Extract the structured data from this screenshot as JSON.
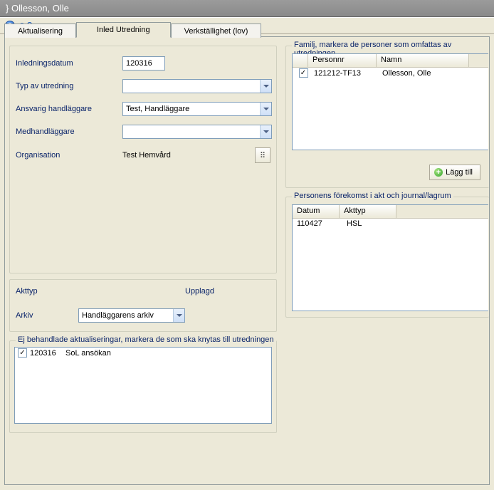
{
  "window": {
    "title": "Ollesson, Olle",
    "title_prefix": "}"
  },
  "tabs": [
    {
      "label": "Aktualisering"
    },
    {
      "label": "Inled Utredning"
    },
    {
      "label": "Verkställighet (lov)"
    }
  ],
  "form": {
    "inledningsdatum_label": "Inledningsdatum",
    "inledningsdatum_value": "120316",
    "typ_label": "Typ av utredning",
    "typ_value": "",
    "ansvarig_label": "Ansvarig handläggare",
    "ansvarig_value": "Test, Handläggare",
    "med_label": "Medhandläggare",
    "med_value": "",
    "org_label": "Organisation",
    "org_value": "Test Hemvård"
  },
  "akt": {
    "akttyp_label": "Akttyp",
    "upplagd_label": "Upplagd",
    "arkiv_label": "Arkiv",
    "arkiv_value": "Handläggarens arkiv"
  },
  "ej_box": {
    "legend": "Ej behandlade aktualiseringar, markera de som ska knytas till utredningen",
    "rows": [
      {
        "checked": true,
        "date": "120316",
        "text": "SoL ansökan"
      }
    ]
  },
  "familj": {
    "legend": "Familj, markera de personer som omfattas av utredningen",
    "cols": {
      "personnr": "Personnr",
      "namn": "Namn"
    },
    "rows": [
      {
        "checked": true,
        "personnr": "121212-TF13",
        "namn": "Ollesson, Olle"
      }
    ],
    "add_button": "Lägg till"
  },
  "forekomst": {
    "legend": "Personens förekomst i akt och journal/lagrum",
    "cols": {
      "datum": "Datum",
      "akttyp": "Akttyp"
    },
    "rows": [
      {
        "datum": "110427",
        "akttyp": "HSL"
      }
    ]
  }
}
